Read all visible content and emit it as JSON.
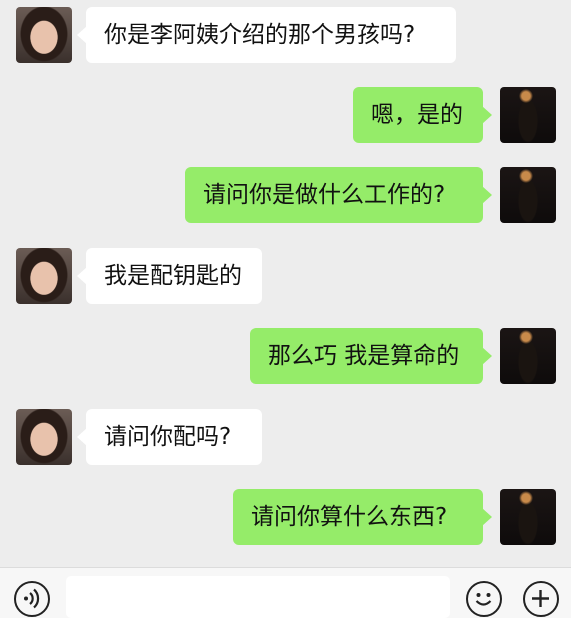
{
  "messages": [
    {
      "side": "left",
      "text": "你是李阿姨介绍的那个男孩吗?"
    },
    {
      "side": "right",
      "text": "嗯，是的"
    },
    {
      "side": "right",
      "text": "请问你是做什么工作的?"
    },
    {
      "side": "left",
      "text": "我是配钥匙的"
    },
    {
      "side": "right",
      "text": "那么巧 我是算命的"
    },
    {
      "side": "left",
      "text": "请问你配吗?"
    },
    {
      "side": "right",
      "text": "请问你算什么东西?"
    }
  ],
  "input_bar": {
    "voice_icon": "voice-icon",
    "emoji_icon": "emoji-icon",
    "more_icon": "plus-icon",
    "input_value": ""
  },
  "colors": {
    "background": "#ededed",
    "sent_bubble": "#95ec69",
    "received_bubble": "#ffffff"
  }
}
